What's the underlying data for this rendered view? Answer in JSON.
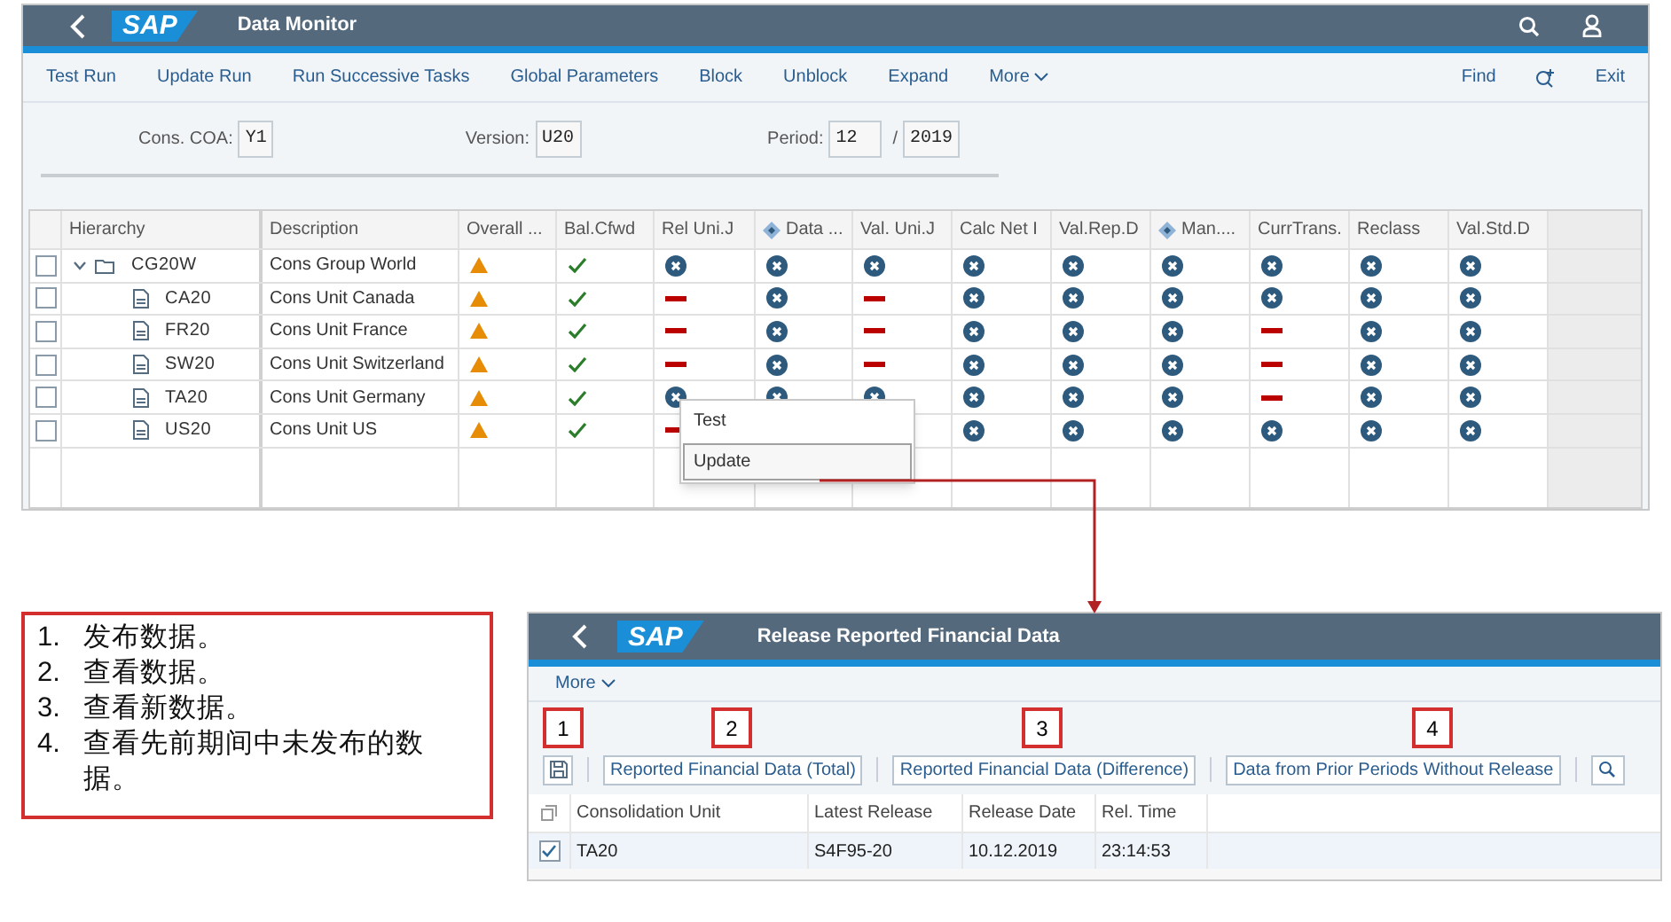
{
  "monitor": {
    "title": "Data Monitor",
    "logo": "SAP",
    "toolbar": [
      "Test Run",
      "Update Run",
      "Run Successive Tasks",
      "Global Parameters",
      "Block",
      "Unblock",
      "Expand"
    ],
    "more": "More",
    "find": "Find",
    "exit": "Exit",
    "filters": {
      "coa_label": "Cons. COA:",
      "coa": "Y1",
      "version_label": "Version:",
      "version": "U20",
      "period_label": "Period:",
      "period": "12",
      "separator": "/",
      "year": "2019"
    },
    "table": {
      "columns": [
        {
          "label": "Hierarchy",
          "kind": "text"
        },
        {
          "label": "Description",
          "kind": "text"
        },
        {
          "label": "Overall ...",
          "kind": "text"
        },
        {
          "label": "Bal.Cfwd",
          "kind": "text"
        },
        {
          "label": "Rel Uni.J",
          "kind": "text"
        },
        {
          "label": "Data ...",
          "kind": "diamond"
        },
        {
          "label": "Val. Uni.J",
          "kind": "text"
        },
        {
          "label": "Calc Net I",
          "kind": "text"
        },
        {
          "label": "Val.Rep.D",
          "kind": "text"
        },
        {
          "label": "Man....",
          "kind": "diamond"
        },
        {
          "label": "CurrTrans.",
          "kind": "text"
        },
        {
          "label": "Reclass",
          "kind": "text"
        },
        {
          "label": "Val.Std.D",
          "kind": "text"
        }
      ],
      "rows": [
        {
          "code": "CG20W",
          "description": "Cons Group World",
          "checked": false,
          "expanded": true,
          "kind": "group",
          "statuses": [
            {
              "kind": "warning"
            },
            {
              "kind": "done"
            },
            {
              "kind": "open"
            },
            {
              "kind": "open"
            },
            {
              "kind": "open"
            },
            {
              "kind": "open"
            },
            {
              "kind": "open"
            },
            {
              "kind": "open"
            },
            {
              "kind": "open"
            },
            {
              "kind": "open"
            },
            {
              "kind": "open"
            }
          ],
          "children": [
            {
              "code": "CA20",
              "description": "Cons Unit Canada",
              "checked": false,
              "kind": "unit",
              "statuses": [
                {
                  "kind": "warning"
                },
                {
                  "kind": "done"
                },
                {
                  "kind": "blocked"
                },
                {
                  "kind": "open"
                },
                {
                  "kind": "blocked"
                },
                {
                  "kind": "open"
                },
                {
                  "kind": "open"
                },
                {
                  "kind": "open"
                },
                {
                  "kind": "open"
                },
                {
                  "kind": "open"
                },
                {
                  "kind": "open"
                }
              ]
            },
            {
              "code": "FR20",
              "description": "Cons Unit France",
              "checked": false,
              "kind": "unit",
              "statuses": [
                {
                  "kind": "warning"
                },
                {
                  "kind": "done"
                },
                {
                  "kind": "blocked"
                },
                {
                  "kind": "open"
                },
                {
                  "kind": "blocked"
                },
                {
                  "kind": "open"
                },
                {
                  "kind": "open"
                },
                {
                  "kind": "open"
                },
                {
                  "kind": "blocked"
                },
                {
                  "kind": "open"
                },
                {
                  "kind": "open"
                }
              ]
            },
            {
              "code": "SW20",
              "description": "Cons Unit Switzerland",
              "checked": false,
              "kind": "unit",
              "statuses": [
                {
                  "kind": "warning"
                },
                {
                  "kind": "done"
                },
                {
                  "kind": "blocked"
                },
                {
                  "kind": "open"
                },
                {
                  "kind": "blocked"
                },
                {
                  "kind": "open"
                },
                {
                  "kind": "open"
                },
                {
                  "kind": "open"
                },
                {
                  "kind": "blocked"
                },
                {
                  "kind": "open"
                },
                {
                  "kind": "open"
                }
              ]
            },
            {
              "code": "TA20",
              "description": "Cons Unit Germany",
              "checked": false,
              "kind": "unit",
              "statuses": [
                {
                  "kind": "warning"
                },
                {
                  "kind": "done"
                },
                {
                  "kind": "open"
                },
                {
                  "kind": "open"
                },
                {
                  "kind": "open"
                },
                {
                  "kind": "open"
                },
                {
                  "kind": "open"
                },
                {
                  "kind": "open"
                },
                {
                  "kind": "blocked"
                },
                {
                  "kind": "open"
                },
                {
                  "kind": "open"
                }
              ]
            },
            {
              "code": "US20",
              "description": "Cons Unit US",
              "checked": false,
              "kind": "unit",
              "statuses": [
                {
                  "kind": "warning"
                },
                {
                  "kind": "done"
                },
                {
                  "kind": "blocked"
                },
                {
                  "kind": "empty"
                },
                {
                  "kind": "empty"
                },
                {
                  "kind": "open"
                },
                {
                  "kind": "open"
                },
                {
                  "kind": "open"
                },
                {
                  "kind": "open"
                },
                {
                  "kind": "open"
                },
                {
                  "kind": "open"
                }
              ]
            }
          ]
        }
      ]
    },
    "context_menu": [
      {
        "label": "Test",
        "selected": false
      },
      {
        "label": "Update",
        "selected": true
      }
    ]
  },
  "steps": [
    {
      "number": "1.",
      "text": "发布数据。"
    },
    {
      "number": "2.",
      "text": "查看数据。"
    },
    {
      "number": "3.",
      "text": "查看新数据。"
    },
    {
      "number": "4.",
      "text": "查看先前期间中未发布的数据。"
    }
  ],
  "release": {
    "title": "Release Reported Financial Data",
    "logo": "SAP",
    "more": "More",
    "markers": [
      "1",
      "2",
      "3",
      "4"
    ],
    "buttons": [
      "Reported Financial Data (Total)",
      "Reported Financial Data (Difference)",
      "Data from Prior Periods Without Release"
    ],
    "columns": [
      "Consolidation Unit",
      "Latest Release",
      "Release Date",
      "Rel. Time"
    ],
    "rows": [
      {
        "checked": true,
        "cells": [
          "TA20",
          "S4F95-20",
          "10.12.2019",
          "23:14:53"
        ]
      }
    ]
  }
}
